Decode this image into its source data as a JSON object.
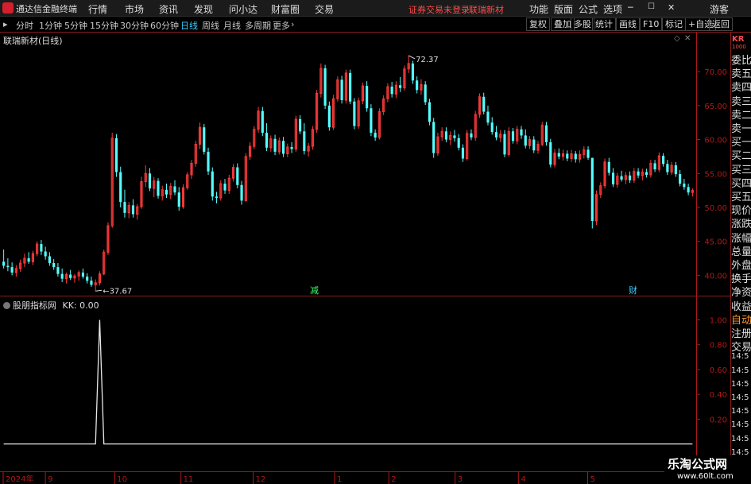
{
  "app": {
    "title": "通达信金融终端"
  },
  "menu": {
    "items": [
      "行情",
      "市场",
      "资讯",
      "发现",
      "问小达",
      "财富圈",
      "交易"
    ],
    "status_warning": "证券交易未登录",
    "stock_name": "联瑞新材",
    "right_items": [
      "功能",
      "版面",
      "公式",
      "选项"
    ],
    "guest": "游客"
  },
  "periods": {
    "items": [
      "分时",
      "1分钟",
      "5分钟",
      "15分钟",
      "30分钟",
      "60分钟",
      "日线",
      "周线",
      "月线",
      "多周期",
      "更多"
    ],
    "active": "日线"
  },
  "toolbar": {
    "items": [
      "复权",
      "叠加",
      "多股",
      "统计",
      "画线",
      "F10",
      "+自选",
      "返回"
    ]
  },
  "price_panel": {
    "title": "联瑞新材(日线)"
  },
  "indicator_panel": {
    "title": "股朋指标网",
    "value_label": "KK: 0.00"
  },
  "side_panel": {
    "code": "KR",
    "code_sub": "1000",
    "rows": [
      "委比",
      "卖五",
      "卖四",
      "卖三",
      "卖二",
      "卖一",
      "买一",
      "买二",
      "买三",
      "买四",
      "买五",
      "现价",
      "涨跌",
      "涨幅",
      "总量",
      "外盘",
      "换手",
      "净资",
      "收益",
      "自动",
      "注册",
      "交易",
      "14:5",
      "14:5",
      "14:5",
      "14:5",
      "14:5",
      "14:5",
      "14:5",
      "14:5"
    ]
  },
  "colors": {
    "up": "#ff3a3a",
    "down": "#54ffff",
    "axis": "#b01818",
    "grid_line": "#8b1a1a",
    "flat": "#ffffff",
    "active_period": "#39d0ff",
    "warning": "#ff4b4b"
  },
  "chart_data": [
    {
      "type": "candlestick",
      "title": "联瑞新材(日线)",
      "y_ticks": [
        40.0,
        45.0,
        50.0,
        55.0,
        60.0,
        65.0,
        70.0
      ],
      "ylim": [
        37.0,
        74.0
      ],
      "annotations": [
        {
          "label": "72.37",
          "kind": "high"
        },
        {
          "label": "37.67",
          "kind": "low"
        }
      ],
      "markers": [
        "减",
        "财"
      ],
      "x_ticks": [
        "2024年",
        "9",
        "10",
        "11",
        "12",
        "1",
        "2",
        "3",
        "4",
        "5"
      ],
      "candles": [
        {
          "o": 42.0,
          "h": 43.8,
          "l": 41.0,
          "c": 41.4
        },
        {
          "o": 41.4,
          "h": 42.5,
          "l": 40.6,
          "c": 41.2
        },
        {
          "o": 41.2,
          "h": 41.9,
          "l": 40.0,
          "c": 40.4
        },
        {
          "o": 40.4,
          "h": 41.5,
          "l": 39.8,
          "c": 41.0
        },
        {
          "o": 41.0,
          "h": 42.3,
          "l": 40.5,
          "c": 41.8
        },
        {
          "o": 41.8,
          "h": 43.2,
          "l": 41.2,
          "c": 42.5
        },
        {
          "o": 42.5,
          "h": 43.4,
          "l": 41.7,
          "c": 42.0
        },
        {
          "o": 42.0,
          "h": 43.6,
          "l": 41.5,
          "c": 43.2
        },
        {
          "o": 43.2,
          "h": 45.0,
          "l": 42.8,
          "c": 44.6
        },
        {
          "o": 44.6,
          "h": 45.2,
          "l": 43.0,
          "c": 43.5
        },
        {
          "o": 43.5,
          "h": 44.2,
          "l": 42.3,
          "c": 42.8
        },
        {
          "o": 42.8,
          "h": 43.4,
          "l": 41.4,
          "c": 41.8
        },
        {
          "o": 41.8,
          "h": 42.4,
          "l": 40.8,
          "c": 41.2
        },
        {
          "o": 41.2,
          "h": 41.8,
          "l": 39.8,
          "c": 40.2
        },
        {
          "o": 40.2,
          "h": 41.0,
          "l": 39.0,
          "c": 39.5
        },
        {
          "o": 39.5,
          "h": 40.4,
          "l": 38.8,
          "c": 40.1
        },
        {
          "o": 40.1,
          "h": 40.8,
          "l": 39.3,
          "c": 39.6
        },
        {
          "o": 39.6,
          "h": 40.2,
          "l": 38.9,
          "c": 39.9
        },
        {
          "o": 39.9,
          "h": 40.7,
          "l": 39.2,
          "c": 40.4
        },
        {
          "o": 40.4,
          "h": 41.0,
          "l": 39.5,
          "c": 39.8
        },
        {
          "o": 39.8,
          "h": 40.3,
          "l": 38.8,
          "c": 39.2
        },
        {
          "o": 39.2,
          "h": 39.8,
          "l": 38.3,
          "c": 38.6
        },
        {
          "o": 38.6,
          "h": 39.4,
          "l": 37.67,
          "c": 38.9
        },
        {
          "o": 38.9,
          "h": 40.6,
          "l": 38.5,
          "c": 40.2
        },
        {
          "o": 40.2,
          "h": 43.8,
          "l": 40.0,
          "c": 43.4
        },
        {
          "o": 43.4,
          "h": 47.8,
          "l": 43.0,
          "c": 47.3
        },
        {
          "o": 47.3,
          "h": 61.0,
          "l": 47.0,
          "c": 60.2
        },
        {
          "o": 60.2,
          "h": 60.8,
          "l": 54.5,
          "c": 55.2
        },
        {
          "o": 55.2,
          "h": 56.0,
          "l": 50.0,
          "c": 50.8
        },
        {
          "o": 50.8,
          "h": 52.6,
          "l": 48.5,
          "c": 49.2
        },
        {
          "o": 49.2,
          "h": 50.8,
          "l": 48.4,
          "c": 50.3
        },
        {
          "o": 50.3,
          "h": 51.2,
          "l": 48.5,
          "c": 49.0
        },
        {
          "o": 49.0,
          "h": 50.5,
          "l": 48.2,
          "c": 50.1
        },
        {
          "o": 50.1,
          "h": 54.5,
          "l": 49.8,
          "c": 53.8
        },
        {
          "o": 53.8,
          "h": 56.2,
          "l": 53.0,
          "c": 55.0
        },
        {
          "o": 55.0,
          "h": 55.8,
          "l": 52.4,
          "c": 52.8
        },
        {
          "o": 52.8,
          "h": 54.5,
          "l": 51.5,
          "c": 53.9
        },
        {
          "o": 53.9,
          "h": 54.3,
          "l": 51.3,
          "c": 51.7
        },
        {
          "o": 51.7,
          "h": 53.2,
          "l": 51.0,
          "c": 52.6
        },
        {
          "o": 52.6,
          "h": 53.5,
          "l": 51.4,
          "c": 51.9
        },
        {
          "o": 51.9,
          "h": 53.6,
          "l": 51.2,
          "c": 53.1
        },
        {
          "o": 53.1,
          "h": 54.0,
          "l": 51.8,
          "c": 52.2
        },
        {
          "o": 52.2,
          "h": 53.0,
          "l": 49.5,
          "c": 50.1
        },
        {
          "o": 50.1,
          "h": 53.4,
          "l": 49.8,
          "c": 52.9
        },
        {
          "o": 52.9,
          "h": 55.2,
          "l": 52.6,
          "c": 54.8
        },
        {
          "o": 54.8,
          "h": 57.0,
          "l": 54.2,
          "c": 56.5
        },
        {
          "o": 56.5,
          "h": 59.8,
          "l": 56.0,
          "c": 59.3
        },
        {
          "o": 59.3,
          "h": 62.5,
          "l": 58.6,
          "c": 61.8
        },
        {
          "o": 61.8,
          "h": 62.3,
          "l": 57.8,
          "c": 58.2
        },
        {
          "o": 58.2,
          "h": 58.8,
          "l": 54.8,
          "c": 55.3
        },
        {
          "o": 55.3,
          "h": 55.9,
          "l": 51.0,
          "c": 51.6
        },
        {
          "o": 51.6,
          "h": 52.3,
          "l": 50.6,
          "c": 51.4
        },
        {
          "o": 51.4,
          "h": 54.0,
          "l": 51.0,
          "c": 53.5
        },
        {
          "o": 53.5,
          "h": 54.2,
          "l": 52.0,
          "c": 52.5
        },
        {
          "o": 52.5,
          "h": 54.8,
          "l": 52.0,
          "c": 54.3
        },
        {
          "o": 54.3,
          "h": 56.4,
          "l": 53.8,
          "c": 55.9
        },
        {
          "o": 55.9,
          "h": 56.5,
          "l": 52.8,
          "c": 53.3
        },
        {
          "o": 53.3,
          "h": 53.9,
          "l": 50.4,
          "c": 51.0
        },
        {
          "o": 51.0,
          "h": 58.0,
          "l": 50.8,
          "c": 57.5
        },
        {
          "o": 57.5,
          "h": 59.6,
          "l": 57.0,
          "c": 59.0
        },
        {
          "o": 59.0,
          "h": 62.0,
          "l": 58.6,
          "c": 61.5
        },
        {
          "o": 61.5,
          "h": 64.8,
          "l": 61.0,
          "c": 64.2
        },
        {
          "o": 64.2,
          "h": 64.8,
          "l": 60.5,
          "c": 61.0
        },
        {
          "o": 61.0,
          "h": 62.4,
          "l": 58.3,
          "c": 58.8
        },
        {
          "o": 58.8,
          "h": 60.6,
          "l": 58.2,
          "c": 60.1
        },
        {
          "o": 60.1,
          "h": 60.7,
          "l": 57.7,
          "c": 58.2
        },
        {
          "o": 58.2,
          "h": 60.3,
          "l": 57.8,
          "c": 59.8
        },
        {
          "o": 59.8,
          "h": 60.4,
          "l": 57.4,
          "c": 57.9
        },
        {
          "o": 57.9,
          "h": 59.4,
          "l": 57.4,
          "c": 58.9
        },
        {
          "o": 58.9,
          "h": 59.6,
          "l": 58.0,
          "c": 58.6
        },
        {
          "o": 58.6,
          "h": 63.5,
          "l": 58.2,
          "c": 63.0
        },
        {
          "o": 63.0,
          "h": 63.6,
          "l": 60.8,
          "c": 61.2
        },
        {
          "o": 61.2,
          "h": 62.4,
          "l": 57.8,
          "c": 58.3
        },
        {
          "o": 58.3,
          "h": 59.5,
          "l": 57.5,
          "c": 59.0
        },
        {
          "o": 59.0,
          "h": 62.0,
          "l": 58.5,
          "c": 61.5
        },
        {
          "o": 61.5,
          "h": 67.3,
          "l": 61.0,
          "c": 66.8
        },
        {
          "o": 66.8,
          "h": 71.2,
          "l": 66.2,
          "c": 70.5
        },
        {
          "o": 70.5,
          "h": 71.0,
          "l": 64.5,
          "c": 65.0
        },
        {
          "o": 65.0,
          "h": 65.6,
          "l": 61.3,
          "c": 61.8
        },
        {
          "o": 61.8,
          "h": 66.6,
          "l": 61.4,
          "c": 66.0
        },
        {
          "o": 66.0,
          "h": 69.3,
          "l": 65.6,
          "c": 68.8
        },
        {
          "o": 68.8,
          "h": 69.4,
          "l": 65.3,
          "c": 65.8
        },
        {
          "o": 65.8,
          "h": 70.3,
          "l": 65.3,
          "c": 69.8
        },
        {
          "o": 69.8,
          "h": 70.3,
          "l": 65.2,
          "c": 65.6
        },
        {
          "o": 65.6,
          "h": 66.1,
          "l": 61.5,
          "c": 62.0
        },
        {
          "o": 62.0,
          "h": 66.2,
          "l": 61.6,
          "c": 65.7
        },
        {
          "o": 65.7,
          "h": 68.4,
          "l": 65.2,
          "c": 67.9
        },
        {
          "o": 67.9,
          "h": 68.6,
          "l": 64.1,
          "c": 64.6
        },
        {
          "o": 64.6,
          "h": 65.2,
          "l": 60.5,
          "c": 61.0
        },
        {
          "o": 61.0,
          "h": 61.5,
          "l": 59.8,
          "c": 60.3
        },
        {
          "o": 60.3,
          "h": 64.6,
          "l": 60.0,
          "c": 64.1
        },
        {
          "o": 64.1,
          "h": 66.5,
          "l": 63.6,
          "c": 66.0
        },
        {
          "o": 66.0,
          "h": 68.3,
          "l": 65.5,
          "c": 67.8
        },
        {
          "o": 67.8,
          "h": 68.5,
          "l": 66.2,
          "c": 66.7
        },
        {
          "o": 66.7,
          "h": 68.6,
          "l": 66.1,
          "c": 68.0
        },
        {
          "o": 68.0,
          "h": 69.2,
          "l": 67.0,
          "c": 67.6
        },
        {
          "o": 67.6,
          "h": 70.9,
          "l": 67.2,
          "c": 70.4
        },
        {
          "o": 70.4,
          "h": 72.37,
          "l": 69.8,
          "c": 71.2
        },
        {
          "o": 71.2,
          "h": 71.6,
          "l": 68.2,
          "c": 68.7
        },
        {
          "o": 68.7,
          "h": 69.3,
          "l": 66.8,
          "c": 67.3
        },
        {
          "o": 67.3,
          "h": 68.9,
          "l": 66.6,
          "c": 68.1
        },
        {
          "o": 68.1,
          "h": 68.6,
          "l": 65.1,
          "c": 65.5
        },
        {
          "o": 65.5,
          "h": 66.0,
          "l": 62.1,
          "c": 62.6
        },
        {
          "o": 62.6,
          "h": 63.2,
          "l": 57.3,
          "c": 58.0
        },
        {
          "o": 58.0,
          "h": 61.0,
          "l": 57.6,
          "c": 60.4
        },
        {
          "o": 60.4,
          "h": 61.8,
          "l": 59.8,
          "c": 61.2
        },
        {
          "o": 61.2,
          "h": 61.8,
          "l": 59.6,
          "c": 60.0
        },
        {
          "o": 60.0,
          "h": 61.2,
          "l": 59.2,
          "c": 60.6
        },
        {
          "o": 60.6,
          "h": 61.4,
          "l": 59.7,
          "c": 60.2
        },
        {
          "o": 60.2,
          "h": 60.8,
          "l": 58.4,
          "c": 58.8
        },
        {
          "o": 58.8,
          "h": 59.3,
          "l": 56.7,
          "c": 57.2
        },
        {
          "o": 57.2,
          "h": 61.4,
          "l": 56.9,
          "c": 60.9
        },
        {
          "o": 60.9,
          "h": 61.5,
          "l": 59.9,
          "c": 60.3
        },
        {
          "o": 60.3,
          "h": 64.2,
          "l": 59.8,
          "c": 63.7
        },
        {
          "o": 63.7,
          "h": 66.8,
          "l": 63.2,
          "c": 66.3
        },
        {
          "o": 66.3,
          "h": 66.9,
          "l": 63.7,
          "c": 64.1
        },
        {
          "o": 64.1,
          "h": 65.0,
          "l": 62.1,
          "c": 62.5
        },
        {
          "o": 62.5,
          "h": 63.3,
          "l": 60.7,
          "c": 61.1
        },
        {
          "o": 61.1,
          "h": 62.0,
          "l": 59.9,
          "c": 60.3
        },
        {
          "o": 60.3,
          "h": 61.4,
          "l": 59.6,
          "c": 60.8
        },
        {
          "o": 60.8,
          "h": 61.4,
          "l": 57.4,
          "c": 57.8
        },
        {
          "o": 57.8,
          "h": 61.8,
          "l": 57.5,
          "c": 61.2
        },
        {
          "o": 61.2,
          "h": 61.7,
          "l": 59.4,
          "c": 59.8
        },
        {
          "o": 59.8,
          "h": 62.0,
          "l": 59.3,
          "c": 61.5
        },
        {
          "o": 61.5,
          "h": 62.0,
          "l": 60.1,
          "c": 60.6
        },
        {
          "o": 60.6,
          "h": 61.5,
          "l": 58.7,
          "c": 59.1
        },
        {
          "o": 59.1,
          "h": 60.5,
          "l": 58.6,
          "c": 60.0
        },
        {
          "o": 60.0,
          "h": 60.5,
          "l": 58.0,
          "c": 58.4
        },
        {
          "o": 58.4,
          "h": 59.8,
          "l": 57.9,
          "c": 59.3
        },
        {
          "o": 59.3,
          "h": 62.6,
          "l": 59.0,
          "c": 62.1
        },
        {
          "o": 62.1,
          "h": 62.6,
          "l": 59.1,
          "c": 59.6
        },
        {
          "o": 59.6,
          "h": 60.1,
          "l": 55.9,
          "c": 56.3
        },
        {
          "o": 56.3,
          "h": 58.6,
          "l": 55.9,
          "c": 58.0
        },
        {
          "o": 58.0,
          "h": 58.7,
          "l": 57.1,
          "c": 57.5
        },
        {
          "o": 57.5,
          "h": 58.5,
          "l": 56.9,
          "c": 57.9
        },
        {
          "o": 57.9,
          "h": 58.4,
          "l": 56.8,
          "c": 57.2
        },
        {
          "o": 57.2,
          "h": 58.5,
          "l": 56.7,
          "c": 57.9
        },
        {
          "o": 57.9,
          "h": 58.3,
          "l": 56.6,
          "c": 57.1
        },
        {
          "o": 57.1,
          "h": 58.4,
          "l": 56.6,
          "c": 57.8
        },
        {
          "o": 57.8,
          "h": 59.0,
          "l": 57.2,
          "c": 58.5
        },
        {
          "o": 58.5,
          "h": 59.0,
          "l": 57.0,
          "c": 57.3
        },
        {
          "o": 57.3,
          "h": 53.0,
          "l": 46.9,
          "c": 48.0
        },
        {
          "o": 48.0,
          "h": 52.5,
          "l": 47.4,
          "c": 51.9
        },
        {
          "o": 51.9,
          "h": 53.7,
          "l": 51.4,
          "c": 53.2
        },
        {
          "o": 53.2,
          "h": 57.2,
          "l": 52.8,
          "c": 56.7
        },
        {
          "o": 56.7,
          "h": 57.3,
          "l": 54.7,
          "c": 55.1
        },
        {
          "o": 55.1,
          "h": 55.8,
          "l": 53.0,
          "c": 53.4
        },
        {
          "o": 53.4,
          "h": 55.1,
          "l": 52.9,
          "c": 54.6
        },
        {
          "o": 54.6,
          "h": 55.4,
          "l": 53.8,
          "c": 54.1
        },
        {
          "o": 54.1,
          "h": 55.2,
          "l": 53.4,
          "c": 54.7
        },
        {
          "o": 54.7,
          "h": 55.3,
          "l": 53.6,
          "c": 54.0
        },
        {
          "o": 54.0,
          "h": 55.8,
          "l": 53.6,
          "c": 55.3
        },
        {
          "o": 55.3,
          "h": 55.8,
          "l": 54.3,
          "c": 54.7
        },
        {
          "o": 54.7,
          "h": 55.7,
          "l": 54.0,
          "c": 55.2
        },
        {
          "o": 55.2,
          "h": 55.7,
          "l": 54.4,
          "c": 54.8
        },
        {
          "o": 54.8,
          "h": 57.0,
          "l": 54.4,
          "c": 56.5
        },
        {
          "o": 56.5,
          "h": 57.0,
          "l": 55.2,
          "c": 55.6
        },
        {
          "o": 55.6,
          "h": 58.1,
          "l": 55.2,
          "c": 57.6
        },
        {
          "o": 57.6,
          "h": 58.0,
          "l": 56.0,
          "c": 56.4
        },
        {
          "o": 56.4,
          "h": 57.0,
          "l": 54.8,
          "c": 55.2
        },
        {
          "o": 55.2,
          "h": 56.7,
          "l": 54.8,
          "c": 56.2
        },
        {
          "o": 56.2,
          "h": 56.7,
          "l": 54.5,
          "c": 54.9
        },
        {
          "o": 54.9,
          "h": 55.5,
          "l": 53.1,
          "c": 53.5
        },
        {
          "o": 53.5,
          "h": 54.2,
          "l": 52.6,
          "c": 53.0
        },
        {
          "o": 53.0,
          "h": 53.5,
          "l": 51.8,
          "c": 52.2
        },
        {
          "o": 52.2,
          "h": 52.8,
          "l": 51.6,
          "c": 52.5
        }
      ]
    },
    {
      "type": "line",
      "title": "股朋指标网",
      "series": [
        {
          "name": "KK",
          "spike_index": 23,
          "spike_value": 1.0
        }
      ],
      "y_ticks": [
        0.2,
        0.4,
        0.6,
        0.8,
        1.0
      ],
      "ylim": [
        -0.22,
        1.08
      ]
    }
  ],
  "watermark": {
    "title": "乐淘公式网",
    "url": "www.60lt.com"
  }
}
